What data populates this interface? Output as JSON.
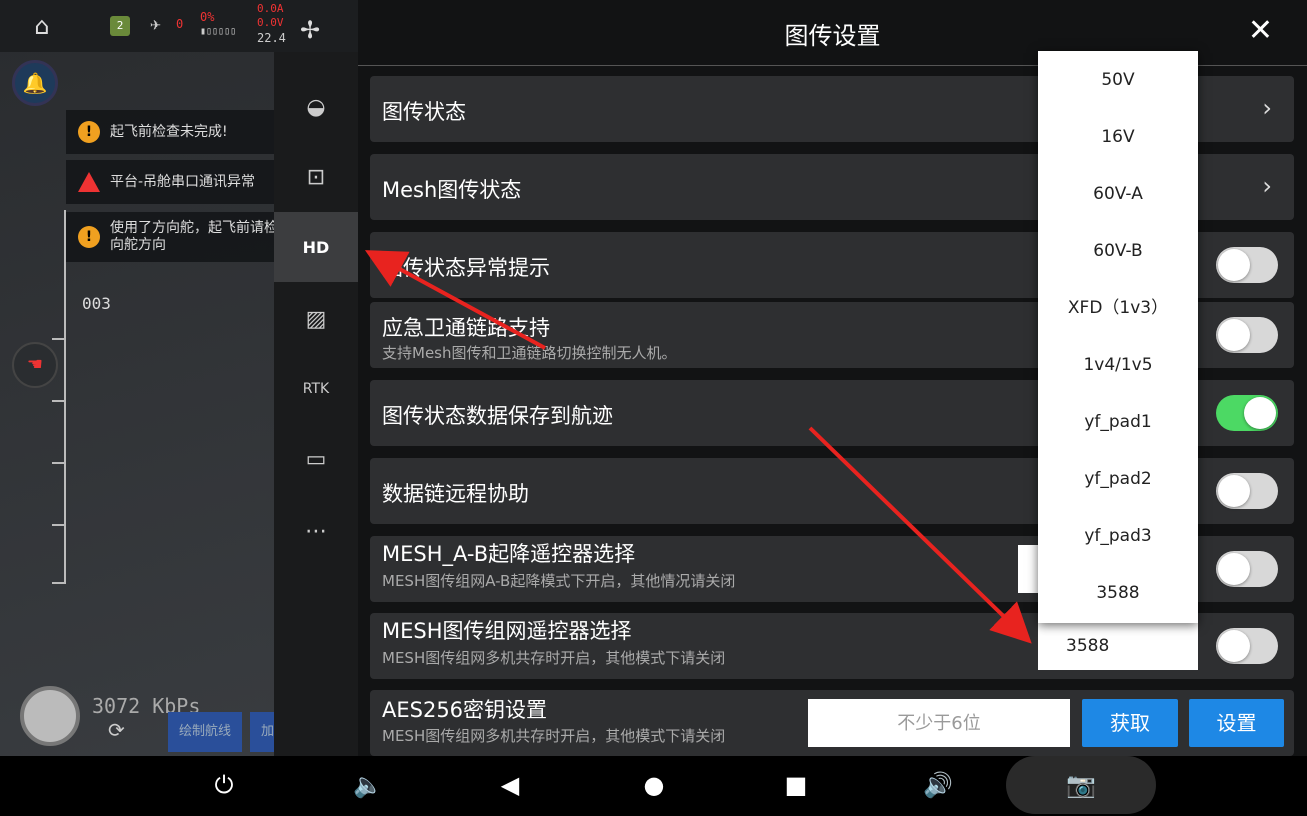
{
  "topbar": {
    "home_icon": "home-icon",
    "notif_count": "2",
    "satellite_count": "0",
    "battery_percent": "0%",
    "readout1": "0.0A",
    "readout2": "0.0V",
    "readout3": "22.4"
  },
  "alerts": [
    {
      "text": "起飞前检查未完成!"
    },
    {
      "text": "平台-吊舱串口通讯异常"
    },
    {
      "text_line1": "使用了方向舵，起飞前请检",
      "text_line2": "向舵方向"
    }
  ],
  "ruler_label": "003",
  "speed": "3072 KbPs",
  "buttons": {
    "draw_route": "绘制航线",
    "load_route": "加载航线"
  },
  "sidemenu": {
    "hd_label": "HD",
    "rtk_label": "RTK"
  },
  "panel": {
    "title": "图传设置",
    "rows": {
      "status": "图传状态",
      "mesh_status": "Mesh图传状态",
      "abnormal_prompt": "图传状态异常提示",
      "satcom_title": "应急卫通链路支持",
      "satcom_sub": "支持Mesh图传和卫通链路切换控制无人机。",
      "save_track": "图传状态数据保存到航迹",
      "remote_assist": "数据链远程协助",
      "mesh_ab_title": "MESH_A-B起降遥控器选择",
      "mesh_ab_sub": "MESH图传组网A-B起降模式下开启，其他情况请关闭",
      "mesh_net_title": "MESH图传组网遥控器选择",
      "mesh_net_sub": "MESH图传组网多机共存时开启，其他模式下请关闭",
      "mesh_net_value": "3588",
      "aes_title": "AES256密钥设置",
      "aes_sub": "MESH图传组网多机共存时开启，其他模式下请关闭",
      "aes_placeholder": "不少于6位",
      "get_btn": "获取",
      "set_btn": "设置"
    },
    "toggles": {
      "abnormal_prompt": false,
      "satcom": false,
      "save_track": true,
      "remote_assist": false,
      "mesh_ab": false,
      "mesh_net": false
    }
  },
  "dropdown": {
    "options": [
      "50V",
      "16V",
      "60V-A",
      "60V-B",
      "XFD（1v3）",
      "1v4/1v5",
      "yf_pad1",
      "yf_pad2",
      "yf_pad3",
      "3588"
    ]
  },
  "colors": {
    "toggle_on": "#4cd964",
    "accent_blue": "#1e88e5",
    "annotation_red": "#e8231f"
  }
}
